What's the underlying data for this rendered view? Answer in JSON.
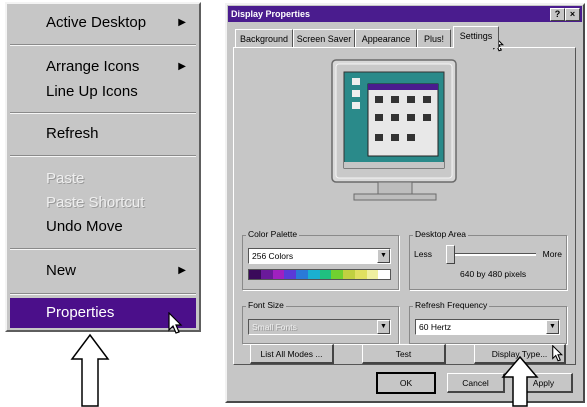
{
  "context_menu": {
    "items": [
      {
        "label": "Active Desktop",
        "submenu": true
      },
      {
        "label": "Arrange Icons",
        "submenu": true
      },
      {
        "label": "Line Up Icons"
      },
      {
        "label": "Refresh"
      },
      {
        "label": "Paste",
        "disabled": true
      },
      {
        "label": "Paste Shortcut",
        "disabled": true
      },
      {
        "label": "Undo Move"
      },
      {
        "label": "New",
        "submenu": true
      },
      {
        "label": "Properties",
        "selected": true
      }
    ],
    "submenu_arrow": "▶"
  },
  "dialog": {
    "title": "Display Properties",
    "title_buttons": {
      "help": "?",
      "close": "×"
    },
    "tabs": [
      "Background",
      "Screen Saver",
      "Appearance",
      "Plus!",
      "Settings"
    ],
    "active_tab": "Settings",
    "color_palette": {
      "label": "Color Palette",
      "value": "256 Colors"
    },
    "desktop_area": {
      "label": "Desktop Area",
      "less": "Less",
      "more": "More",
      "resolution": "640 by 480 pixels",
      "slider_fraction": 0
    },
    "font_size": {
      "label": "Font Size",
      "value": "Small Fonts"
    },
    "refresh_frequency": {
      "label": "Refresh Frequency",
      "value": "60 Hertz"
    },
    "buttons": {
      "list_all_modes": "List All Modes ...",
      "test": "Test",
      "display_type": "Display Type..."
    },
    "footer": {
      "ok": "OK",
      "cancel": "Cancel",
      "apply": "Apply"
    }
  },
  "colors": {
    "face": "#c6c6c6",
    "title_bar": "#4a1c8e",
    "menu_highlight": "#4b0f8a",
    "monitor_desktop": "#2a8a8a"
  },
  "icons": [
    "submenu-arrow-icon",
    "pointer-cursor-icon",
    "up-arrow-callout-icon",
    "monitor-preview-icon",
    "dropdown-arrow-icon"
  ]
}
